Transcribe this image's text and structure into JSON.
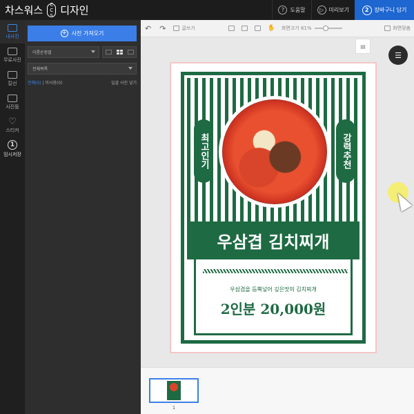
{
  "header": {
    "app_title_left": "차스워스",
    "app_title_right": "디자인",
    "logo_mark_top": "C",
    "logo_mark_mid": "C",
    "logo_mark_bottom": "S",
    "help_label": "도움말",
    "preview_label": "미리보기",
    "cart_label": "장바구니 담기",
    "cart_step": "2",
    "help_icon": "?",
    "preview_icon": "▷"
  },
  "rail": {
    "items": [
      {
        "label": "내사진",
        "icon": "photo-icon"
      },
      {
        "label": "무료사진",
        "icon": "free-photo-icon"
      },
      {
        "label": "칼선",
        "icon": "cut-line-icon"
      },
      {
        "label": "사진틀",
        "icon": "frame-icon"
      },
      {
        "label": "스티커",
        "icon": "heart-icon"
      },
      {
        "label": "임시저장",
        "icon": "temp-save-icon",
        "badge": "1"
      }
    ]
  },
  "panel": {
    "import_label": "사진 가져오기",
    "sort_value": "이름순정렬",
    "folder_value": "전체목록",
    "filter_all": "전체(0)",
    "filter_unused": "미사용(0)",
    "filter_sep": "|",
    "bulk_label": "일괄 사진 넣기"
  },
  "toolbar": {
    "undo": "↶",
    "redo": "↷",
    "text_label": "글쓰기",
    "zoom_label": "화면크기 61%",
    "fit_label": "화면맞춤"
  },
  "poster": {
    "left_pill": "최고인기",
    "right_pill": "강력추천",
    "title": "우삼겹 김치찌개",
    "subtitle": "우삼겹을 듬뿍넣어 깊은맛의 김치찌개",
    "price": "2인분 20,000원"
  },
  "filmstrip": {
    "page_number": "1"
  },
  "colors": {
    "brand_green": "#1e6a43",
    "accent_blue": "#3b7ee8",
    "cart_blue": "#1e66d0"
  }
}
